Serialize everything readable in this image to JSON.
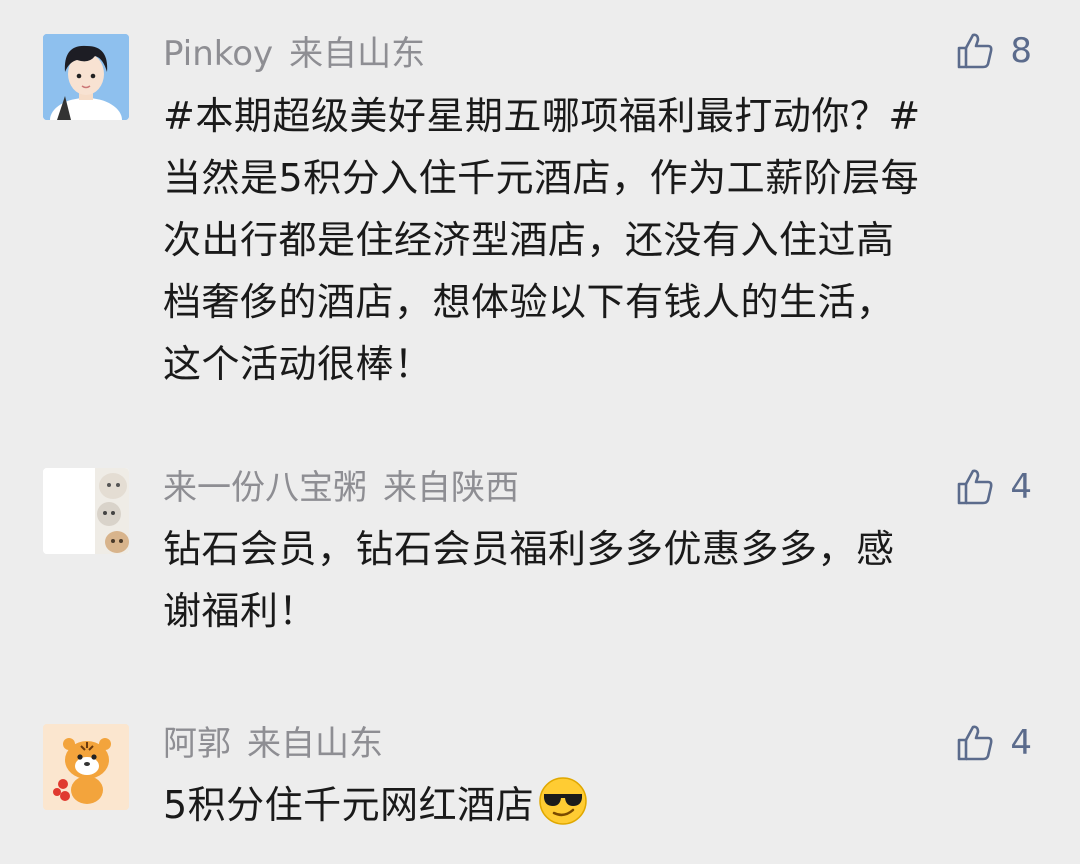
{
  "comments": [
    {
      "username": "Pinkoy",
      "location": "来自山东",
      "likes": "8",
      "avatar_icon": "boy-avatar-icon",
      "lines": [
        "#本期超级美好星期五哪项福利最打动你？#",
        "当然是5积分入住千元酒店，作为工薪阶层每",
        "次出行都是住经济型酒店，还没有入住过高",
        "档奢侈的酒店，想体验以下有钱人的生活，",
        "这个活动很棒！"
      ]
    },
    {
      "username": "来一份八宝粥",
      "location": "来自陕西",
      "likes": "4",
      "avatar_icon": "cats-avatar-icon",
      "lines": [
        "钻石会员，钻石会员福利多多优惠多多，感",
        "谢福利！"
      ]
    },
    {
      "username": "阿郭",
      "location": "来自山东",
      "likes": "4",
      "avatar_icon": "tiger-avatar-icon",
      "lines": [
        "5积分住千元网红酒店"
      ],
      "emoji": "sunglasses-emoji-icon"
    }
  ],
  "colors": {
    "background": "#ededed",
    "meta_text": "#8e8e93",
    "like_icon": "#5b6b8c",
    "body_text": "#1a1a1a"
  }
}
